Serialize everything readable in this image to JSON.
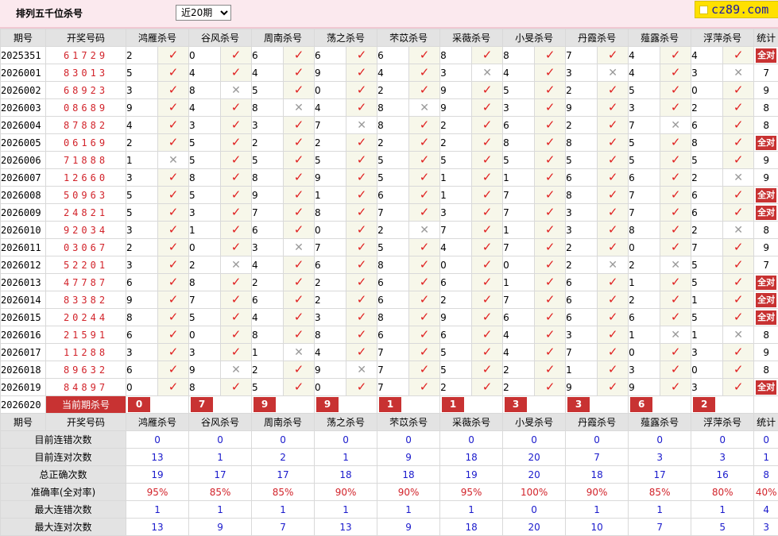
{
  "header": {
    "title": "排列五千位杀号",
    "period_select": "近20期",
    "logo_text": "cz89.com"
  },
  "columns": {
    "issue": "期号",
    "draw": "开奖号码",
    "experts": [
      "鸿雁杀号",
      "谷风杀号",
      "周南杀号",
      "荡之杀号",
      "芣苡杀号",
      "采薇杀号",
      "小旻杀号",
      "丹霞杀号",
      "薤露杀号",
      "浮萍杀号"
    ],
    "stat": "统计"
  },
  "all_correct_label": "全对",
  "rows": [
    {
      "issue": "2025351",
      "draw": "61729",
      "kills": [
        "2",
        "0",
        "6",
        "6",
        "6",
        "8",
        "8",
        "7",
        "4",
        "4"
      ],
      "marks": [
        1,
        1,
        1,
        1,
        1,
        1,
        1,
        1,
        1,
        1
      ],
      "stat": "全对"
    },
    {
      "issue": "2026001",
      "draw": "83013",
      "kills": [
        "5",
        "4",
        "4",
        "9",
        "4",
        "3",
        "4",
        "3",
        "4",
        "3"
      ],
      "marks": [
        1,
        1,
        1,
        1,
        1,
        0,
        1,
        0,
        1,
        0
      ],
      "stat": "7"
    },
    {
      "issue": "2026002",
      "draw": "68923",
      "kills": [
        "3",
        "8",
        "5",
        "0",
        "2",
        "9",
        "5",
        "2",
        "5",
        "0"
      ],
      "marks": [
        1,
        0,
        1,
        1,
        1,
        1,
        1,
        1,
        1,
        1
      ],
      "stat": "9"
    },
    {
      "issue": "2026003",
      "draw": "08689",
      "kills": [
        "9",
        "4",
        "8",
        "4",
        "8",
        "9",
        "3",
        "9",
        "3",
        "2"
      ],
      "marks": [
        1,
        1,
        0,
        1,
        0,
        1,
        1,
        1,
        1,
        1
      ],
      "stat": "8"
    },
    {
      "issue": "2026004",
      "draw": "87882",
      "kills": [
        "4",
        "3",
        "3",
        "7",
        "8",
        "2",
        "6",
        "2",
        "7",
        "6"
      ],
      "marks": [
        1,
        1,
        1,
        0,
        1,
        1,
        1,
        1,
        0,
        1
      ],
      "stat": "8"
    },
    {
      "issue": "2026005",
      "draw": "06169",
      "kills": [
        "2",
        "5",
        "2",
        "2",
        "2",
        "2",
        "8",
        "8",
        "5",
        "8"
      ],
      "marks": [
        1,
        1,
        1,
        1,
        1,
        1,
        1,
        1,
        1,
        1
      ],
      "stat": "全对"
    },
    {
      "issue": "2026006",
      "draw": "71888",
      "kills": [
        "1",
        "5",
        "5",
        "5",
        "5",
        "5",
        "5",
        "5",
        "5",
        "5"
      ],
      "marks": [
        0,
        1,
        1,
        1,
        1,
        1,
        1,
        1,
        1,
        1
      ],
      "stat": "9"
    },
    {
      "issue": "2026007",
      "draw": "12660",
      "kills": [
        "3",
        "8",
        "8",
        "9",
        "5",
        "1",
        "1",
        "6",
        "6",
        "2"
      ],
      "marks": [
        1,
        1,
        1,
        1,
        1,
        1,
        1,
        1,
        1,
        0
      ],
      "stat": "9"
    },
    {
      "issue": "2026008",
      "draw": "50963",
      "kills": [
        "5",
        "5",
        "9",
        "1",
        "6",
        "1",
        "7",
        "8",
        "7",
        "6"
      ],
      "marks": [
        1,
        1,
        1,
        1,
        1,
        1,
        1,
        1,
        1,
        1
      ],
      "stat": "全对"
    },
    {
      "issue": "2026009",
      "draw": "24821",
      "kills": [
        "5",
        "3",
        "7",
        "8",
        "7",
        "3",
        "7",
        "3",
        "7",
        "6"
      ],
      "marks": [
        1,
        1,
        1,
        1,
        1,
        1,
        1,
        1,
        1,
        1
      ],
      "stat": "全对"
    },
    {
      "issue": "2026010",
      "draw": "92034",
      "kills": [
        "3",
        "1",
        "6",
        "0",
        "2",
        "7",
        "1",
        "3",
        "8",
        "2"
      ],
      "marks": [
        1,
        1,
        1,
        1,
        0,
        1,
        1,
        1,
        1,
        0
      ],
      "stat": "8"
    },
    {
      "issue": "2026011",
      "draw": "03067",
      "kills": [
        "2",
        "0",
        "3",
        "7",
        "5",
        "4",
        "7",
        "2",
        "0",
        "7"
      ],
      "marks": [
        1,
        1,
        0,
        1,
        1,
        1,
        1,
        1,
        1,
        1
      ],
      "stat": "9"
    },
    {
      "issue": "2026012",
      "draw": "52201",
      "kills": [
        "3",
        "2",
        "4",
        "6",
        "8",
        "0",
        "0",
        "2",
        "2",
        "5"
      ],
      "marks": [
        1,
        0,
        1,
        1,
        1,
        1,
        1,
        0,
        0,
        1
      ],
      "stat": "7"
    },
    {
      "issue": "2026013",
      "draw": "47787",
      "kills": [
        "6",
        "8",
        "2",
        "2",
        "6",
        "6",
        "1",
        "6",
        "1",
        "5"
      ],
      "marks": [
        1,
        1,
        1,
        1,
        1,
        1,
        1,
        1,
        1,
        1
      ],
      "stat": "全对"
    },
    {
      "issue": "2026014",
      "draw": "83382",
      "kills": [
        "9",
        "7",
        "6",
        "2",
        "6",
        "2",
        "7",
        "6",
        "2",
        "1"
      ],
      "marks": [
        1,
        1,
        1,
        1,
        1,
        1,
        1,
        1,
        1,
        1
      ],
      "stat": "全对"
    },
    {
      "issue": "2026015",
      "draw": "20244",
      "kills": [
        "8",
        "5",
        "4",
        "3",
        "8",
        "9",
        "6",
        "6",
        "6",
        "5"
      ],
      "marks": [
        1,
        1,
        1,
        1,
        1,
        1,
        1,
        1,
        1,
        1
      ],
      "stat": "全对"
    },
    {
      "issue": "2026016",
      "draw": "21591",
      "kills": [
        "6",
        "0",
        "8",
        "8",
        "6",
        "6",
        "4",
        "3",
        "1",
        "1"
      ],
      "marks": [
        1,
        1,
        1,
        1,
        1,
        1,
        1,
        1,
        0,
        0
      ],
      "stat": "8"
    },
    {
      "issue": "2026017",
      "draw": "11288",
      "kills": [
        "3",
        "3",
        "1",
        "4",
        "7",
        "5",
        "4",
        "7",
        "0",
        "3"
      ],
      "marks": [
        1,
        1,
        0,
        1,
        1,
        1,
        1,
        1,
        1,
        1
      ],
      "stat": "9"
    },
    {
      "issue": "2026018",
      "draw": "89632",
      "kills": [
        "6",
        "9",
        "2",
        "9",
        "7",
        "5",
        "2",
        "1",
        "3",
        "0"
      ],
      "marks": [
        1,
        0,
        1,
        0,
        1,
        1,
        1,
        1,
        1,
        1
      ],
      "stat": "8"
    },
    {
      "issue": "2026019",
      "draw": "84897",
      "kills": [
        "0",
        "8",
        "5",
        "0",
        "7",
        "2",
        "2",
        "9",
        "9",
        "3"
      ],
      "marks": [
        1,
        1,
        1,
        1,
        1,
        1,
        1,
        1,
        1,
        1
      ],
      "stat": "全对"
    }
  ],
  "current": {
    "issue": "2026020",
    "label": "当前期杀号",
    "kills": [
      "0",
      "7",
      "9",
      "9",
      "1",
      "1",
      "3",
      "3",
      "6",
      "2"
    ]
  },
  "summary": [
    {
      "label": "目前连错次数",
      "values": [
        "0",
        "0",
        "0",
        "0",
        "0",
        "0",
        "0",
        "0",
        "0",
        "0"
      ],
      "stat": "0",
      "red": false
    },
    {
      "label": "目前连对次数",
      "values": [
        "13",
        "1",
        "2",
        "1",
        "9",
        "18",
        "20",
        "7",
        "3",
        "3"
      ],
      "stat": "1",
      "red": false
    },
    {
      "label": "总正确次数",
      "values": [
        "19",
        "17",
        "17",
        "18",
        "18",
        "19",
        "20",
        "18",
        "17",
        "16"
      ],
      "stat": "8",
      "red": false
    },
    {
      "label": "准确率(全对率)",
      "values": [
        "95%",
        "85%",
        "85%",
        "90%",
        "90%",
        "95%",
        "100%",
        "90%",
        "85%",
        "80%"
      ],
      "stat": "40%",
      "red": true
    },
    {
      "label": "最大连错次数",
      "values": [
        "1",
        "1",
        "1",
        "1",
        "1",
        "1",
        "0",
        "1",
        "1",
        "1"
      ],
      "stat": "4",
      "red": false
    },
    {
      "label": "最大连对次数",
      "values": [
        "13",
        "9",
        "7",
        "13",
        "9",
        "18",
        "20",
        "10",
        "7",
        "5"
      ],
      "stat": "3",
      "red": false
    }
  ]
}
